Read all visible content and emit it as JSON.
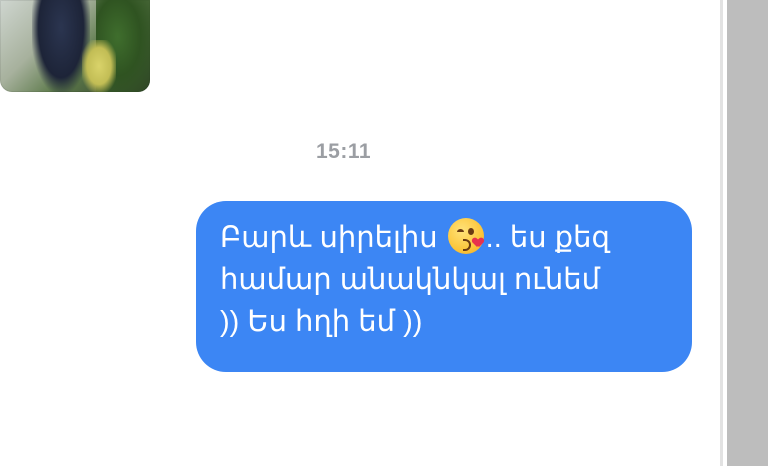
{
  "conversation": {
    "timestamp": "15:11",
    "outgoing_message": {
      "line1_before_emoji": "Բարև սիրելիս",
      "emoji": "kissing-face-with-heart",
      "line1_after_emoji": ".. ես քեզ",
      "line2": "համար անակնկալ ունեմ",
      "line3": ")) Ես հղի եմ ))"
    },
    "previous_message": {
      "type": "photo"
    }
  },
  "colors": {
    "bubble": "#3c86f4",
    "timestamp": "#9b9ea3",
    "scrollbar_thumb": "#bdbdbd"
  }
}
